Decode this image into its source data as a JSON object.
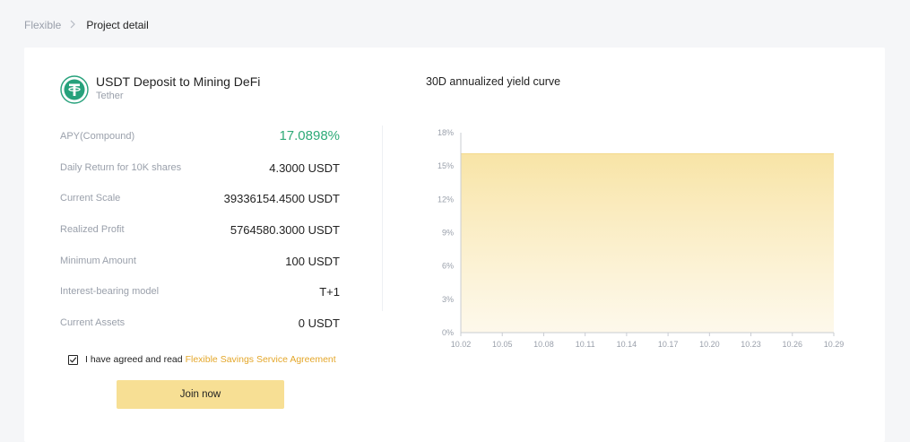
{
  "breadcrumb": {
    "parent": "Flexible",
    "current": "Project detail"
  },
  "project": {
    "title": "USDT Deposit to Mining DeFi",
    "subtitle": "Tether",
    "logo_icon": "tether-logo-icon",
    "logo_color": "#26a17b"
  },
  "details": [
    {
      "label": "APY(Compound)",
      "value": "17.0898%"
    },
    {
      "label": "Daily Return for 10K shares",
      "value": "4.3000 USDT"
    },
    {
      "label": "Current Scale",
      "value": "39336154.4500 USDT"
    },
    {
      "label": "Realized Profit",
      "value": "5764580.3000 USDT"
    },
    {
      "label": "Minimum Amount",
      "value": "100 USDT"
    },
    {
      "label": "Interest-bearing model",
      "value": "T+1"
    },
    {
      "label": "Current Assets",
      "value": "0 USDT"
    }
  ],
  "agreement": {
    "checked": true,
    "text": "I have agreed and read",
    "link": "Flexible Savings Service Agreement"
  },
  "join_button": {
    "label": "Join now",
    "color": "#f7df94"
  },
  "colors": {
    "apy_green": "#2eaa78",
    "accent_gold": "#e4a72a"
  },
  "chart_title": "30D annualized yield curve",
  "chart_data": {
    "type": "area",
    "title": "30D annualized yield curve",
    "xlabel": "",
    "ylabel": "",
    "x_ticks": [
      "10.02",
      "10.05",
      "10.08",
      "10.11",
      "10.14",
      "10.17",
      "10.20",
      "10.23",
      "10.26",
      "10.29"
    ],
    "y_ticks": [
      "0%",
      "3%",
      "6%",
      "9%",
      "12%",
      "15%",
      "18%"
    ],
    "ylim": [
      0,
      18
    ],
    "x": [
      "10.02",
      "10.29"
    ],
    "series": [
      {
        "values": [
          16.1,
          16.1
        ]
      }
    ],
    "grid": false,
    "fill_color": "#f8e4a6"
  }
}
